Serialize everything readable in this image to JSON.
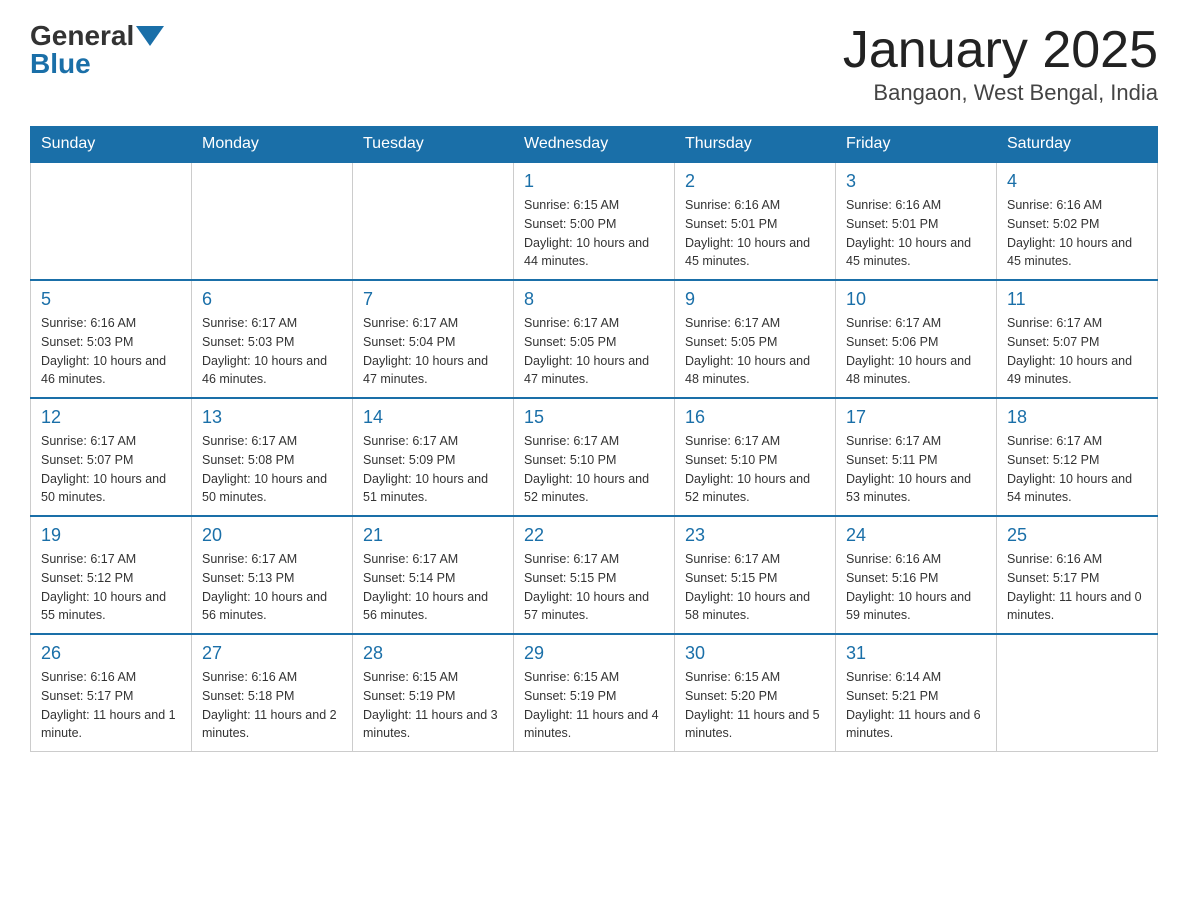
{
  "header": {
    "logo_general": "General",
    "logo_blue": "Blue",
    "title": "January 2025",
    "subtitle": "Bangaon, West Bengal, India"
  },
  "weekdays": [
    "Sunday",
    "Monday",
    "Tuesday",
    "Wednesday",
    "Thursday",
    "Friday",
    "Saturday"
  ],
  "weeks": [
    [
      {
        "day": "",
        "info": ""
      },
      {
        "day": "",
        "info": ""
      },
      {
        "day": "",
        "info": ""
      },
      {
        "day": "1",
        "info": "Sunrise: 6:15 AM\nSunset: 5:00 PM\nDaylight: 10 hours\nand 44 minutes."
      },
      {
        "day": "2",
        "info": "Sunrise: 6:16 AM\nSunset: 5:01 PM\nDaylight: 10 hours\nand 45 minutes."
      },
      {
        "day": "3",
        "info": "Sunrise: 6:16 AM\nSunset: 5:01 PM\nDaylight: 10 hours\nand 45 minutes."
      },
      {
        "day": "4",
        "info": "Sunrise: 6:16 AM\nSunset: 5:02 PM\nDaylight: 10 hours\nand 45 minutes."
      }
    ],
    [
      {
        "day": "5",
        "info": "Sunrise: 6:16 AM\nSunset: 5:03 PM\nDaylight: 10 hours\nand 46 minutes."
      },
      {
        "day": "6",
        "info": "Sunrise: 6:17 AM\nSunset: 5:03 PM\nDaylight: 10 hours\nand 46 minutes."
      },
      {
        "day": "7",
        "info": "Sunrise: 6:17 AM\nSunset: 5:04 PM\nDaylight: 10 hours\nand 47 minutes."
      },
      {
        "day": "8",
        "info": "Sunrise: 6:17 AM\nSunset: 5:05 PM\nDaylight: 10 hours\nand 47 minutes."
      },
      {
        "day": "9",
        "info": "Sunrise: 6:17 AM\nSunset: 5:05 PM\nDaylight: 10 hours\nand 48 minutes."
      },
      {
        "day": "10",
        "info": "Sunrise: 6:17 AM\nSunset: 5:06 PM\nDaylight: 10 hours\nand 48 minutes."
      },
      {
        "day": "11",
        "info": "Sunrise: 6:17 AM\nSunset: 5:07 PM\nDaylight: 10 hours\nand 49 minutes."
      }
    ],
    [
      {
        "day": "12",
        "info": "Sunrise: 6:17 AM\nSunset: 5:07 PM\nDaylight: 10 hours\nand 50 minutes."
      },
      {
        "day": "13",
        "info": "Sunrise: 6:17 AM\nSunset: 5:08 PM\nDaylight: 10 hours\nand 50 minutes."
      },
      {
        "day": "14",
        "info": "Sunrise: 6:17 AM\nSunset: 5:09 PM\nDaylight: 10 hours\nand 51 minutes."
      },
      {
        "day": "15",
        "info": "Sunrise: 6:17 AM\nSunset: 5:10 PM\nDaylight: 10 hours\nand 52 minutes."
      },
      {
        "day": "16",
        "info": "Sunrise: 6:17 AM\nSunset: 5:10 PM\nDaylight: 10 hours\nand 52 minutes."
      },
      {
        "day": "17",
        "info": "Sunrise: 6:17 AM\nSunset: 5:11 PM\nDaylight: 10 hours\nand 53 minutes."
      },
      {
        "day": "18",
        "info": "Sunrise: 6:17 AM\nSunset: 5:12 PM\nDaylight: 10 hours\nand 54 minutes."
      }
    ],
    [
      {
        "day": "19",
        "info": "Sunrise: 6:17 AM\nSunset: 5:12 PM\nDaylight: 10 hours\nand 55 minutes."
      },
      {
        "day": "20",
        "info": "Sunrise: 6:17 AM\nSunset: 5:13 PM\nDaylight: 10 hours\nand 56 minutes."
      },
      {
        "day": "21",
        "info": "Sunrise: 6:17 AM\nSunset: 5:14 PM\nDaylight: 10 hours\nand 56 minutes."
      },
      {
        "day": "22",
        "info": "Sunrise: 6:17 AM\nSunset: 5:15 PM\nDaylight: 10 hours\nand 57 minutes."
      },
      {
        "day": "23",
        "info": "Sunrise: 6:17 AM\nSunset: 5:15 PM\nDaylight: 10 hours\nand 58 minutes."
      },
      {
        "day": "24",
        "info": "Sunrise: 6:16 AM\nSunset: 5:16 PM\nDaylight: 10 hours\nand 59 minutes."
      },
      {
        "day": "25",
        "info": "Sunrise: 6:16 AM\nSunset: 5:17 PM\nDaylight: 11 hours\nand 0 minutes."
      }
    ],
    [
      {
        "day": "26",
        "info": "Sunrise: 6:16 AM\nSunset: 5:17 PM\nDaylight: 11 hours\nand 1 minute."
      },
      {
        "day": "27",
        "info": "Sunrise: 6:16 AM\nSunset: 5:18 PM\nDaylight: 11 hours\nand 2 minutes."
      },
      {
        "day": "28",
        "info": "Sunrise: 6:15 AM\nSunset: 5:19 PM\nDaylight: 11 hours\nand 3 minutes."
      },
      {
        "day": "29",
        "info": "Sunrise: 6:15 AM\nSunset: 5:19 PM\nDaylight: 11 hours\nand 4 minutes."
      },
      {
        "day": "30",
        "info": "Sunrise: 6:15 AM\nSunset: 5:20 PM\nDaylight: 11 hours\nand 5 minutes."
      },
      {
        "day": "31",
        "info": "Sunrise: 6:14 AM\nSunset: 5:21 PM\nDaylight: 11 hours\nand 6 minutes."
      },
      {
        "day": "",
        "info": ""
      }
    ]
  ]
}
